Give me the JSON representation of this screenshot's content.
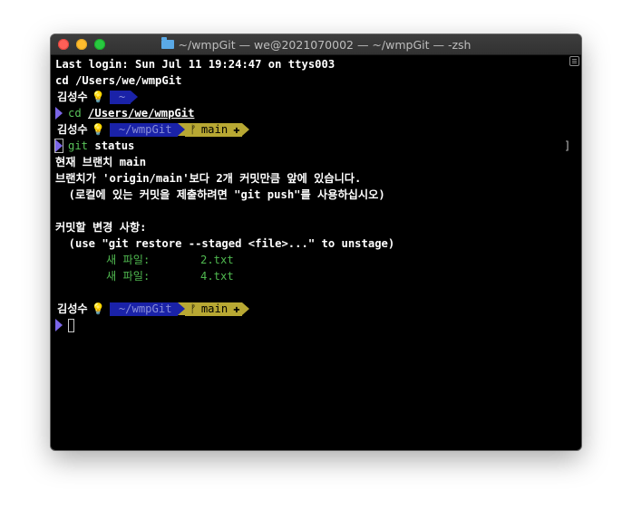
{
  "window": {
    "title": "~/wmpGit — we@2021070002 — ~/wmpGit — -zsh"
  },
  "colors": {
    "background": "#000000",
    "prompt_dir_segment": "#1a22a8",
    "prompt_git_segment": "#b8a833",
    "prompt_caret": "#7b66e8",
    "command": "#5ac45a",
    "new_file": "#4fb84f"
  },
  "icons": {
    "prompt_icon": "lightbulb",
    "branch_icon": "git-branch",
    "folder_icon": "folder"
  },
  "terminal": {
    "last_login": "Last login: Sun Jul 11 19:24:47 on ttys003",
    "cd_line": "cd /Users/we/wmpGit",
    "prompt1": {
      "user": "김성수",
      "bulb": "💡",
      "dir": "~"
    },
    "cmd1": {
      "name": "cd",
      "arg": "/Users/we/wmpGit"
    },
    "prompt2": {
      "user": "김성수",
      "bulb": "💡",
      "dir": "~/wmpGit",
      "branch_symbol": "ᚠ",
      "branch": "main",
      "status_mark": "✚"
    },
    "cmd2": {
      "name": "git",
      "arg": "status"
    },
    "output": {
      "line1": "현재 브랜치 main",
      "line2": "브랜치가 'origin/main'보다 2개 커밋만큼 앞에 있습니다.",
      "line3": "  (로컬에 있는 커밋을 제출하려면 \"git push\"를 사용하십시오)",
      "line4": "커밋할 변경 사항:",
      "line5": "  (use \"git restore --staged <file>...\" to unstage)",
      "files": [
        {
          "label": "새 파일:",
          "name": "2.txt"
        },
        {
          "label": "새 파일:",
          "name": "4.txt"
        }
      ]
    },
    "prompt3": {
      "user": "김성수",
      "bulb": "💡",
      "dir": "~/wmpGit",
      "branch_symbol": "ᚠ",
      "branch": "main",
      "status_mark": "✚"
    }
  }
}
